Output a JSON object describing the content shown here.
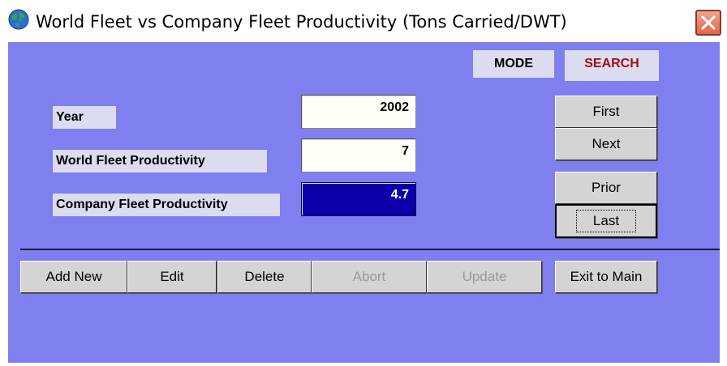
{
  "window": {
    "title": "World Fleet vs Company Fleet Productivity (Tons Carried/DWT)"
  },
  "mode": {
    "label": "MODE",
    "value": "SEARCH",
    "value_color": "#a01010"
  },
  "fields": [
    {
      "label": "Year",
      "value": "2002"
    },
    {
      "label": "World Fleet Productivity",
      "value": "7"
    },
    {
      "label": "Company Fleet  Productivity",
      "value": "4.7"
    }
  ],
  "nav_buttons": {
    "first": "First",
    "next": "Next",
    "prior": "Prior",
    "last": "Last"
  },
  "action_buttons": {
    "add_new": "Add New",
    "edit": "Edit",
    "delete": "Delete",
    "abort": "Abort",
    "update": "Update",
    "exit": "Exit to Main"
  },
  "icons": {
    "app": "globe-icon",
    "close": "close-icon"
  },
  "colors": {
    "client_background": "#7f7fef",
    "selected_field": "#0b00a8"
  }
}
